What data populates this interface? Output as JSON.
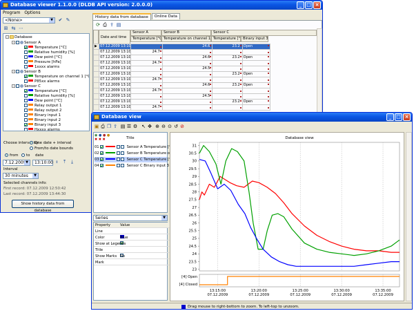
{
  "viewer": {
    "title": "Database viewer  1.1.0.0  (DLDB API version: 2.0.0.0)",
    "menu": [
      "Program",
      "Options"
    ],
    "filter_combo": "<None>",
    "tabs": [
      "History data from database",
      "Online Data"
    ],
    "tree": {
      "root": "Database",
      "sensors": [
        {
          "name": "Sensor A",
          "channels": [
            {
              "label": "Temperature [°C]",
              "checked": true,
              "color": "#ff0000"
            },
            {
              "label": "Relative humidity [%]",
              "checked": false,
              "color": "#00a000"
            },
            {
              "label": "Dew point [°C]",
              "checked": false,
              "color": "#0000ff"
            },
            {
              "label": "Pressure [hPa]",
              "checked": false,
              "color": "#ff8000"
            },
            {
              "label": "1xxxx alarms",
              "checked": false,
              "color": "#ff0000"
            }
          ]
        },
        {
          "name": "Sensor B",
          "channels": [
            {
              "label": "Temperature on channel 1 [°C]",
              "checked": true,
              "color": "#00a000"
            },
            {
              "label": "P85xx alarms",
              "checked": false,
              "color": "#ff0000"
            }
          ]
        },
        {
          "name": "Sensor C",
          "channels": [
            {
              "label": "Temperature [°C]",
              "checked": true,
              "color": "#0000ff"
            },
            {
              "label": "Relative humidity [%]",
              "checked": false,
              "color": "#00a000"
            },
            {
              "label": "Dew point [°C]",
              "checked": false,
              "color": "#0000ff"
            },
            {
              "label": "Relay output 1",
              "checked": false,
              "color": "#ff8000"
            },
            {
              "label": "Relay output 2",
              "checked": false,
              "color": "#ff8000"
            },
            {
              "label": "Binary input 1",
              "checked": false,
              "color": "#ff8000"
            },
            {
              "label": "Binary input 2",
              "checked": false,
              "color": "#ff8000"
            },
            {
              "label": "Binary input 3",
              "checked": true,
              "color": "#ff8000"
            },
            {
              "label": "Hxxxx alarms",
              "checked": false,
              "color": "#ff0000"
            }
          ]
        }
      ]
    },
    "interval": {
      "choose_label": "Choose interval by:",
      "option1": "One date + interval",
      "option2": "From/to date bounds",
      "from_label": "from",
      "to_label": "to",
      "date_label": "date",
      "date_value": "7.12.2009",
      "time_value": "13:10:00",
      "interval_label": "Interval",
      "interval_value": "30 minutes"
    },
    "info": {
      "heading": "Selected channels info:",
      "first": "First record: 07.12.2009  12:50:42",
      "last": "Last record: 07.12.2009  13:44:30"
    },
    "show_button": "Show history data from database",
    "grid": {
      "date_header": "Date and time",
      "group_headers": [
        "Sensor A",
        "Sensor B",
        "Sensor C"
      ],
      "col_headers": [
        "Temperature [°C]",
        "Temperature on channel 1 [°C]",
        "Temperature [°C]",
        "Binary input 3"
      ],
      "rows": [
        {
          "t": "07.12.2009 13:10:00",
          "a": "",
          "b": "24.6",
          "c": "23.2",
          "d": "Open"
        },
        {
          "t": "07.12.2009 13:10:04",
          "a": "24.7",
          "b": "",
          "c": "",
          "d": ""
        },
        {
          "t": "07.12.2009 13:10:11",
          "a": "",
          "b": "24.6",
          "c": "23.2",
          "d": "Open"
        },
        {
          "t": "07.12.2009 13:10:14",
          "a": "24.7",
          "b": "",
          "c": "",
          "d": ""
        },
        {
          "t": "07.12.2009 13:10:21",
          "a": "",
          "b": "24.5",
          "c": "",
          "d": ""
        },
        {
          "t": "07.12.2009 13:10:22",
          "a": "",
          "b": "",
          "c": "23.2",
          "d": "Open"
        },
        {
          "t": "07.12.2009 13:10:24",
          "a": "24.7",
          "b": "",
          "c": "",
          "d": ""
        },
        {
          "t": "07.12.2009 13:10:31",
          "a": "",
          "b": "24.6",
          "c": "23.2",
          "d": "Open"
        },
        {
          "t": "07.12.2009 13:10:34",
          "a": "24.7",
          "b": "",
          "c": "",
          "d": ""
        },
        {
          "t": "07.12.2009 13:10:41",
          "a": "",
          "b": "24.5",
          "c": "",
          "d": ""
        },
        {
          "t": "07.12.2009 13:10:42",
          "a": "",
          "b": "",
          "c": "23.2",
          "d": "Open"
        },
        {
          "t": "07.12.2009 13:10:44",
          "a": "24.7",
          "b": "",
          "c": "",
          "d": ""
        }
      ]
    }
  },
  "dbview": {
    "title": "Database view",
    "series_header": "Title",
    "series": [
      {
        "num": "01",
        "name": "Sensor A Temperature [°C]",
        "color": "#ff0000"
      },
      {
        "num": "02",
        "name": "Sensor B Temperature on ch",
        "color": "#00a000"
      },
      {
        "num": "03",
        "name": "Sensor C Temperature [°C]",
        "color": "#0000ff"
      },
      {
        "num": "04",
        "name": "Sensor C Binary input 3",
        "color": "#ff8000"
      }
    ],
    "series_combo": "Series",
    "props_headers": [
      "Property",
      "Value"
    ],
    "props": [
      {
        "p": "Line",
        "v": ""
      },
      {
        "p": "Color",
        "v": "Blue"
      },
      {
        "p": "Show at Legend",
        "v": "Yes"
      },
      {
        "p": "Title",
        "v": ""
      },
      {
        "p": "Show Marks",
        "v": "No"
      },
      {
        "p": "Mark",
        "v": ""
      }
    ],
    "status": "Drag mouse to right-bottom to zoom. To left-top to unzoom."
  },
  "chart_data": {
    "type": "line",
    "title": "Database view",
    "ylim": [
      22.9,
      31.2
    ],
    "yticks": [
      "31",
      "30.5",
      "30",
      "29.5",
      "29",
      "28.5",
      "28",
      "27.5",
      "27",
      "26.5",
      "26",
      "25.5",
      "25",
      "24.5",
      "24",
      "23.5",
      "23"
    ],
    "xticks": [
      {
        "time": "13:15:00",
        "date": "07.12.2009"
      },
      {
        "time": "13:20:00",
        "date": "07.12.2009"
      },
      {
        "time": "13:25:00",
        "date": "07.12.2009"
      },
      {
        "time": "13:30:00",
        "date": "07.12.2009"
      },
      {
        "time": "13:35:00",
        "date": "07.12.2009"
      }
    ],
    "x_range_minutes": [
      12.8,
      37.0
    ],
    "binary_labels": [
      "[4] Open",
      "[4] Closed"
    ],
    "series": [
      {
        "name": "Sensor A Temperature [°C]",
        "color": "#ff0000",
        "x": [
          12.8,
          13.1,
          13.4,
          14.0,
          14.6,
          15.3,
          15.9,
          16.5,
          17.3,
          18.2,
          19.2,
          20.0,
          21.0,
          22.0,
          23.0,
          24.0,
          25.5,
          27.0,
          28.5,
          30.0,
          31.5,
          33.0,
          34.5,
          36.0,
          37.0
        ],
        "values": [
          27.5,
          28.0,
          27.8,
          28.5,
          28.3,
          29.0,
          28.8,
          28.6,
          28.4,
          28.3,
          28.7,
          28.6,
          28.3,
          27.9,
          27.3,
          26.6,
          25.8,
          25.2,
          24.8,
          24.5,
          24.3,
          24.2,
          24.2,
          24.1,
          24.1
        ]
      },
      {
        "name": "Sensor B Temperature on ch",
        "color": "#00a000",
        "x": [
          12.8,
          13.3,
          14.0,
          14.8,
          15.4,
          16.0,
          16.7,
          17.4,
          18.2,
          18.8,
          19.3,
          19.9,
          20.5,
          21.0,
          21.6,
          22.3,
          23.0,
          24.0,
          25.5,
          27.0,
          28.5,
          30.0,
          31.5,
          33.0,
          34.5,
          36.0,
          37.0
        ],
        "values": [
          30.5,
          31.0,
          30.6,
          29.8,
          28.5,
          30.0,
          30.8,
          30.6,
          30.0,
          28.0,
          26.0,
          24.3,
          24.3,
          25.5,
          26.5,
          26.6,
          26.4,
          25.6,
          24.7,
          24.3,
          24.1,
          24.0,
          23.9,
          24.0,
          24.2,
          24.5,
          24.9
        ]
      },
      {
        "name": "Sensor C Temperature [°C]",
        "color": "#0000ff",
        "x": [
          12.8,
          13.5,
          14.2,
          15.0,
          15.8,
          16.6,
          17.5,
          18.3,
          19.0,
          19.7,
          20.5,
          21.5,
          22.5,
          23.5,
          24.5,
          25.5,
          27.0,
          28.5,
          30.0,
          31.5,
          33.0,
          34.5,
          36.0,
          37.0
        ],
        "values": [
          30.1,
          30.0,
          29.2,
          28.2,
          28.5,
          28.1,
          27.2,
          26.6,
          25.7,
          25.0,
          24.3,
          23.8,
          23.5,
          23.3,
          23.2,
          23.2,
          23.2,
          23.2,
          23.2,
          23.2,
          23.3,
          23.4,
          23.5,
          23.5
        ]
      },
      {
        "name": "Sensor C Binary input 3",
        "color": "#ff8000",
        "x": [
          12.8,
          16.2,
          16.2,
          37.0
        ],
        "values": [
          0,
          0,
          1,
          1
        ]
      }
    ]
  }
}
